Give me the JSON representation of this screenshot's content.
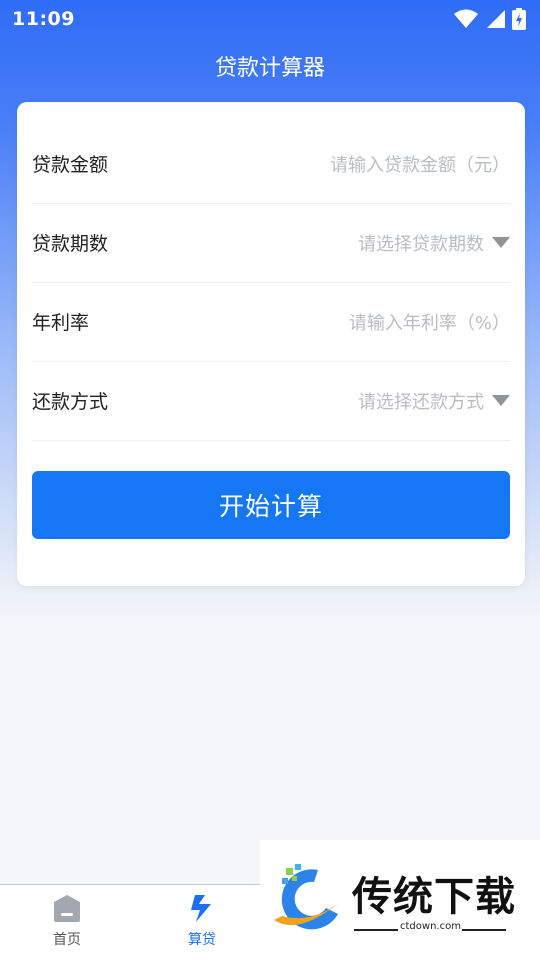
{
  "status_bar": {
    "time": "11:09",
    "icons": [
      "wifi-icon",
      "signal-icon",
      "battery-charging-icon"
    ]
  },
  "header": {
    "title": "贷款计算器"
  },
  "form": {
    "rows": [
      {
        "label": "贷款金额",
        "placeholder": "请输入贷款金额（元）",
        "type": "input"
      },
      {
        "label": "贷款期数",
        "placeholder": "请选择贷款期数",
        "type": "select"
      },
      {
        "label": "年利率",
        "placeholder": "请输入年利率（%）",
        "type": "input"
      },
      {
        "label": "还款方式",
        "placeholder": "请选择还款方式",
        "type": "select"
      }
    ],
    "submit_label": "开始计算"
  },
  "tabbar": {
    "tabs": [
      {
        "label": "首页",
        "icon": "home-icon",
        "active": false
      },
      {
        "label": "算贷",
        "icon": "calculator-bolt-icon",
        "active": true
      }
    ]
  },
  "watermark": {
    "brand": "传统下载",
    "url": "ctdown.com"
  },
  "colors": {
    "primary": "#1677f5",
    "header": "#2f6cf6",
    "active_tab": "#1d6ff2",
    "inactive_tab": "#555555"
  }
}
